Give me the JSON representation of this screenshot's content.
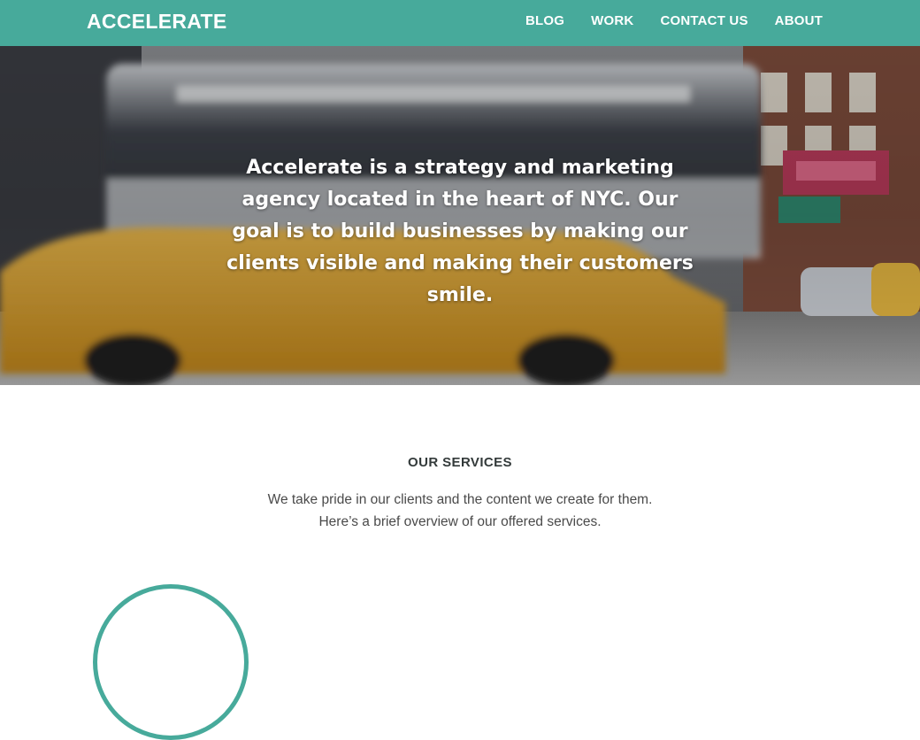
{
  "header": {
    "logo": "ACCELERATE",
    "nav": [
      {
        "label": "BLOG"
      },
      {
        "label": "WORK"
      },
      {
        "label": "CONTACT US"
      },
      {
        "label": "ABOUT"
      }
    ]
  },
  "hero": {
    "text": "Accelerate is a strategy and marketing agency located in the heart of NYC. Our goal is to build businesses by making our clients visible and making their customers smile."
  },
  "services": {
    "heading": "OUR SERVICES",
    "intro_line1": "We take pride in our clients and the content we create for them.",
    "intro_line2": "Here’s a brief overview of our offered services."
  },
  "colors": {
    "accent": "#47aa9b",
    "text": "#4a4a4a",
    "heading": "#333a3a"
  },
  "icons": {
    "service_icon": "service-circle-icon"
  }
}
